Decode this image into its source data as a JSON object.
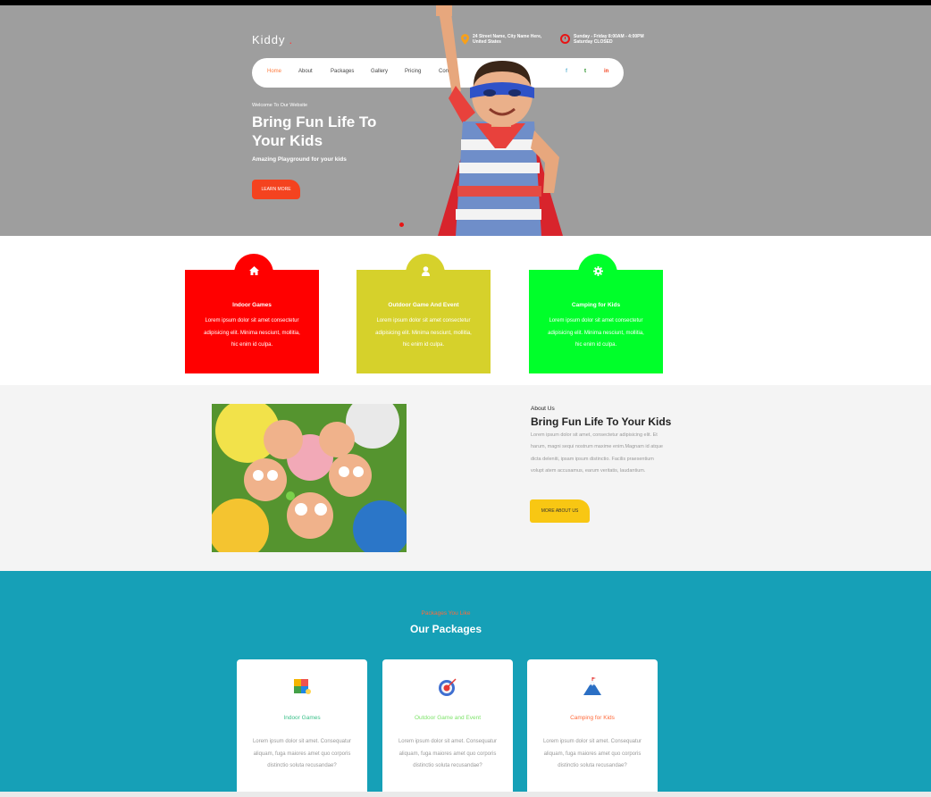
{
  "header": {
    "logo": "Kiddy",
    "logo_dot": ".",
    "address_line1": "24 Street Name, City Name Here,",
    "address_line2": "United States",
    "hours_line1": "Sunday - Friday 8:00AM - 4:00PM",
    "hours_line2": "Saturday CLOSED"
  },
  "nav": {
    "items": [
      {
        "label": "Home"
      },
      {
        "label": "About"
      },
      {
        "label": "Packages"
      },
      {
        "label": "Gallery"
      },
      {
        "label": "Pricing"
      },
      {
        "label": "Contact"
      }
    ],
    "social": [
      {
        "label": "f",
        "icon": "facebook-icon",
        "color": "#69b8d6"
      },
      {
        "label": "t",
        "icon": "twitter-icon",
        "color": "#1a8a1a"
      },
      {
        "label": "in",
        "icon": "linkedin-icon",
        "color": "#f4431f"
      }
    ]
  },
  "hero": {
    "welcome": "Welcome To Our Website",
    "title": "Bring Fun Life To Your Kids",
    "subtitle": "Amazing Playground for your kids",
    "button": "LEARN MORE"
  },
  "features": [
    {
      "title": "Indoor Games",
      "text": "Lorem ipsum dolor sit amet consectetur adipisicing elit. Minima nesciunt, mollitia, hic enim id culpa.",
      "color": "#ff0000",
      "icon": "home-icon"
    },
    {
      "title": "Outdoor Game And Event",
      "text": "Lorem ipsum dolor sit amet consectetur adipisicing elit. Minima nesciunt, mollitia, hic enim id culpa.",
      "color": "#d6d12b",
      "icon": "user-icon"
    },
    {
      "title": "Camping for Kids",
      "text": "Lorem ipsum dolor sit amet consectetur adipisicing elit. Minima nesciunt, mollitia, hic enim id culpa.",
      "color": "#00ff2a",
      "icon": "gear-icon"
    }
  ],
  "about": {
    "label": "About Us",
    "title": "Bring Fun Life To Your Kids",
    "text": "Lorem ipsum dolor sit amet, consectetur adipisicing elit. Et harum, magni sequi nostrum maxime enim.Magnam id atque dicta deleniti, ipsam ipsum distinctio. Facilis praesentium volupt atem accusamus, earum veritatis, laudantium.",
    "button": "MORE ABOUT US"
  },
  "packages": {
    "label": "Packages You Like",
    "title": "Our Packages",
    "items": [
      {
        "name": "Indoor Games",
        "color": "#3cc08a",
        "icon": "puzzle-icon",
        "text": "Lorem ipsum dolor sit amet. Consequatur aliquam, fuga maiores amet quo corporis distinctio soluta recusandae?"
      },
      {
        "name": "Outdoor Game and Event",
        "color": "#7ee36a",
        "icon": "target-icon",
        "text": "Lorem ipsum dolor sit amet. Consequatur aliquam, fuga maiores amet quo corporis distinctio soluta recusandae?"
      },
      {
        "name": "Camping for Kids",
        "color": "#ff6a3a",
        "icon": "mountain-icon",
        "text": "Lorem ipsum dolor sit amet. Consequatur aliquam, fuga maiores amet quo corporis distinctio soluta recusandae?"
      }
    ]
  }
}
